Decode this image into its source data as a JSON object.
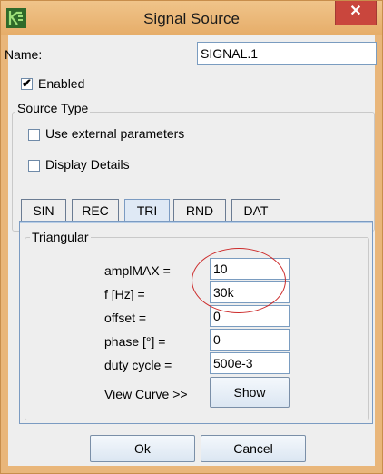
{
  "window": {
    "title": "Signal Source",
    "close_glyph": "✕",
    "app_icon": "app-logo-icon"
  },
  "name_row": {
    "label": "Name:",
    "value": "SIGNAL.1"
  },
  "enabled": {
    "label": "Enabled",
    "checked": true
  },
  "source_type": {
    "legend": "Source Type",
    "use_external": {
      "label": "Use external parameters",
      "checked": false
    },
    "display_details": {
      "label": "Display Details",
      "checked": false
    }
  },
  "tabs": [
    {
      "label": "SIN",
      "active": false
    },
    {
      "label": "REC",
      "active": false
    },
    {
      "label": "TRI",
      "active": true
    },
    {
      "label": "RND",
      "active": false
    },
    {
      "label": "DAT",
      "active": false
    }
  ],
  "triangular": {
    "legend": "Triangular",
    "params": [
      {
        "label": "amplMAX =",
        "value": "10"
      },
      {
        "label": "f [Hz] =",
        "value": "30k"
      },
      {
        "label": "offset =",
        "value": "0"
      },
      {
        "label": "phase [°] =",
        "value": "0"
      },
      {
        "label": "duty cycle =",
        "value": "500e-3"
      }
    ],
    "view_curve_label": "View Curve  >>",
    "show_button": "Show"
  },
  "footer": {
    "ok": "Ok",
    "cancel": "Cancel"
  },
  "colors": {
    "titlebar": "#e9b67a",
    "close_button": "#c9463d",
    "annotation_ellipse": "#cc2a2a"
  }
}
